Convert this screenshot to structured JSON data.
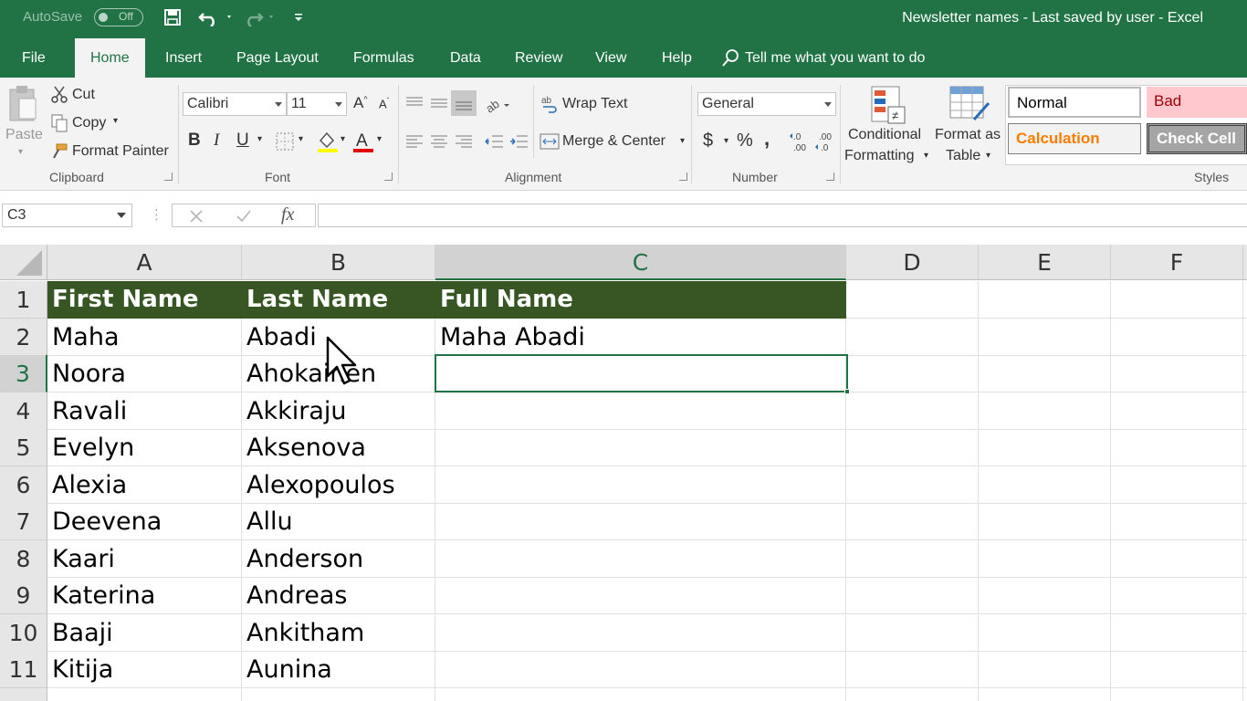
{
  "titlebar": {
    "autosave_label": "AutoSave",
    "autosave_state": "Off",
    "document_title": "Newsletter names  -  Last saved by user  -  Excel"
  },
  "tabs": [
    {
      "label": "File",
      "active": false
    },
    {
      "label": "Home",
      "active": true
    },
    {
      "label": "Insert",
      "active": false
    },
    {
      "label": "Page Layout",
      "active": false
    },
    {
      "label": "Formulas",
      "active": false
    },
    {
      "label": "Data",
      "active": false
    },
    {
      "label": "Review",
      "active": false
    },
    {
      "label": "View",
      "active": false
    },
    {
      "label": "Help",
      "active": false
    }
  ],
  "tellme": {
    "placeholder": "Tell me what you want to do"
  },
  "ribbon": {
    "clipboard": {
      "group_label": "Clipboard",
      "paste": "Paste",
      "cut": "Cut",
      "copy": "Copy",
      "format_painter": "Format Painter"
    },
    "font": {
      "group_label": "Font",
      "font_name": "Calibri",
      "font_size": "11",
      "bold": "B",
      "italic": "I",
      "underline": "U"
    },
    "alignment": {
      "group_label": "Alignment",
      "wrap_text": "Wrap Text",
      "merge_center": "Merge & Center"
    },
    "number": {
      "group_label": "Number",
      "format": "General",
      "currency": "$",
      "percent": "%",
      "comma": ","
    },
    "styles": {
      "group_label": "Styles",
      "conditional_formatting_1": "Conditional",
      "conditional_formatting_2": "Formatting",
      "format_as_table_1": "Format as",
      "format_as_table_2": "Table",
      "normal": "Normal",
      "bad": "Bad",
      "calculation": "Calculation",
      "check_cell": "Check Cell"
    }
  },
  "formula_bar": {
    "name_box": "C3",
    "fx": "fx",
    "content": ""
  },
  "sheet": {
    "columns": [
      "A",
      "B",
      "C",
      "D",
      "E",
      "F"
    ],
    "rows": [
      {
        "num": "1",
        "a": "First Name",
        "b": "Last Name",
        "c": "Full Name"
      },
      {
        "num": "2",
        "a": "Maha",
        "b": "Abadi",
        "c": "Maha Abadi"
      },
      {
        "num": "3",
        "a": "Noora",
        "b": "Ahokainen",
        "c": ""
      },
      {
        "num": "4",
        "a": "Ravali",
        "b": "Akkiraju",
        "c": ""
      },
      {
        "num": "5",
        "a": "Evelyn",
        "b": "Aksenova",
        "c": ""
      },
      {
        "num": "6",
        "a": "Alexia",
        "b": "Alexopoulos",
        "c": ""
      },
      {
        "num": "7",
        "a": "Deevena",
        "b": "Allu",
        "c": ""
      },
      {
        "num": "8",
        "a": "Kaari",
        "b": "Anderson",
        "c": ""
      },
      {
        "num": "9",
        "a": "Katerina",
        "b": "Andreas",
        "c": ""
      },
      {
        "num": "10",
        "a": "Baaji",
        "b": "Ankitham",
        "c": ""
      },
      {
        "num": "11",
        "a": "Kitija",
        "b": "Aunina",
        "c": ""
      }
    ]
  },
  "colors": {
    "excel_green": "#217346",
    "header_fill": "#375623",
    "bad_fill": "#ffc7ce",
    "bad_text": "#9c0006",
    "calc_text": "#fa7d00",
    "check_fill": "#a5a5a5"
  }
}
